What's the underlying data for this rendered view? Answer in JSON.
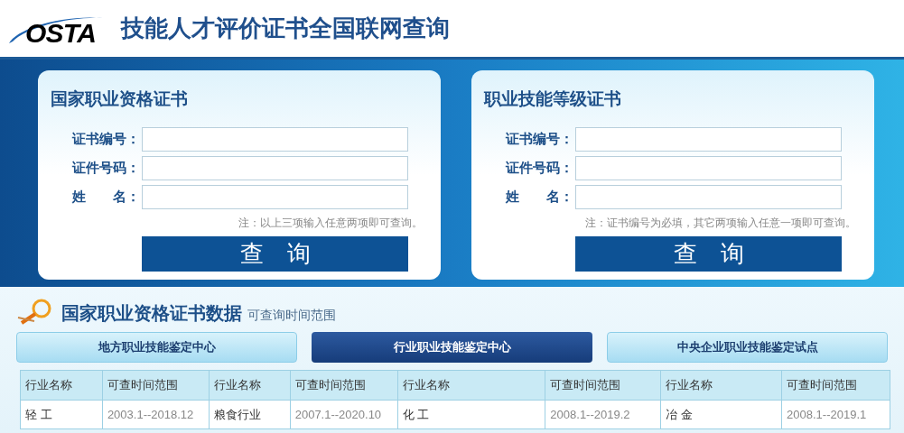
{
  "header": {
    "logo_text": "OSTA",
    "title": "技能人才评价证书全国联网查询"
  },
  "forms": [
    {
      "title": "国家职业资格证书",
      "fields": [
        {
          "label": "证书编号："
        },
        {
          "label": "证件号码："
        },
        {
          "label": "姓　　名："
        }
      ],
      "note": "注：以上三项输入任意两项即可查询。",
      "button": "查　询"
    },
    {
      "title": "职业技能等级证书",
      "fields": [
        {
          "label": "证书编号："
        },
        {
          "label": "证件号码："
        },
        {
          "label": "姓　　名："
        }
      ],
      "note": "注：证书编号为必填，其它两项输入任意一项即可查询。",
      "button": "查　询"
    }
  ],
  "data_section": {
    "title": "国家职业资格证书数据",
    "subtitle": "可查询时间范围",
    "tabs": [
      {
        "label": "地方职业技能鉴定中心",
        "selected": false
      },
      {
        "label": "行业职业技能鉴定中心",
        "selected": true
      },
      {
        "label": "中央企业职业技能鉴定试点",
        "selected": false
      }
    ],
    "table": {
      "columns": [
        "行业名称",
        "可查时间范围",
        "行业名称",
        "可查时间范围",
        "行业名称",
        "可查时间范围",
        "行业名称",
        "可查时间范围"
      ],
      "rows": [
        [
          "轻 工",
          "2003.1--2018.12",
          "粮食行业",
          "2007.1--2020.10",
          "化 工",
          "2008.1--2019.2",
          "冶 金",
          "2008.1--2019.1"
        ]
      ]
    }
  }
}
